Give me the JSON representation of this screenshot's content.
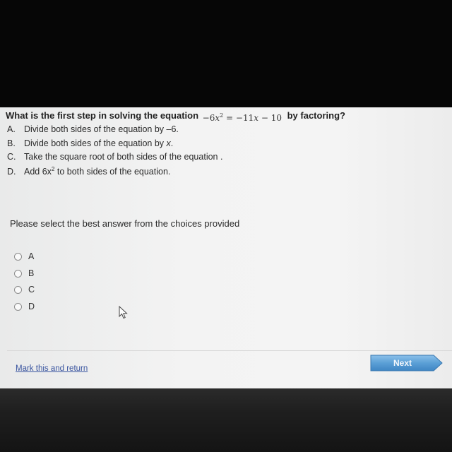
{
  "question": {
    "prefix": "What is the first step in solving the equation",
    "eq_a": "−6",
    "eq_var": "x",
    "eq_exp": "2",
    "eq_b": " = −11",
    "eq_var2": "x",
    "eq_c": " − 10",
    "suffix": "by factoring?"
  },
  "choices": [
    {
      "letter": "A.",
      "text": "Divide both sides of the equation by –6."
    },
    {
      "letter": "B.",
      "text": "Divide both sides of the equation by",
      "var": "x",
      "end": "."
    },
    {
      "letter": "C.",
      "text": "Take the square root of both sides of the equation ."
    },
    {
      "letter": "D.",
      "text": "Add 6x",
      "exp": "2",
      "end": " to both sides of the equation."
    }
  ],
  "prompt": "Please select the best answer from the choices provided",
  "options": [
    "A",
    "B",
    "C",
    "D"
  ],
  "footer": {
    "mark_link": "Mark this and return",
    "next": "Next"
  },
  "colors": {
    "next_button": "#5b9fd6",
    "link": "#3a55a0",
    "page": "#f3f3f3"
  }
}
